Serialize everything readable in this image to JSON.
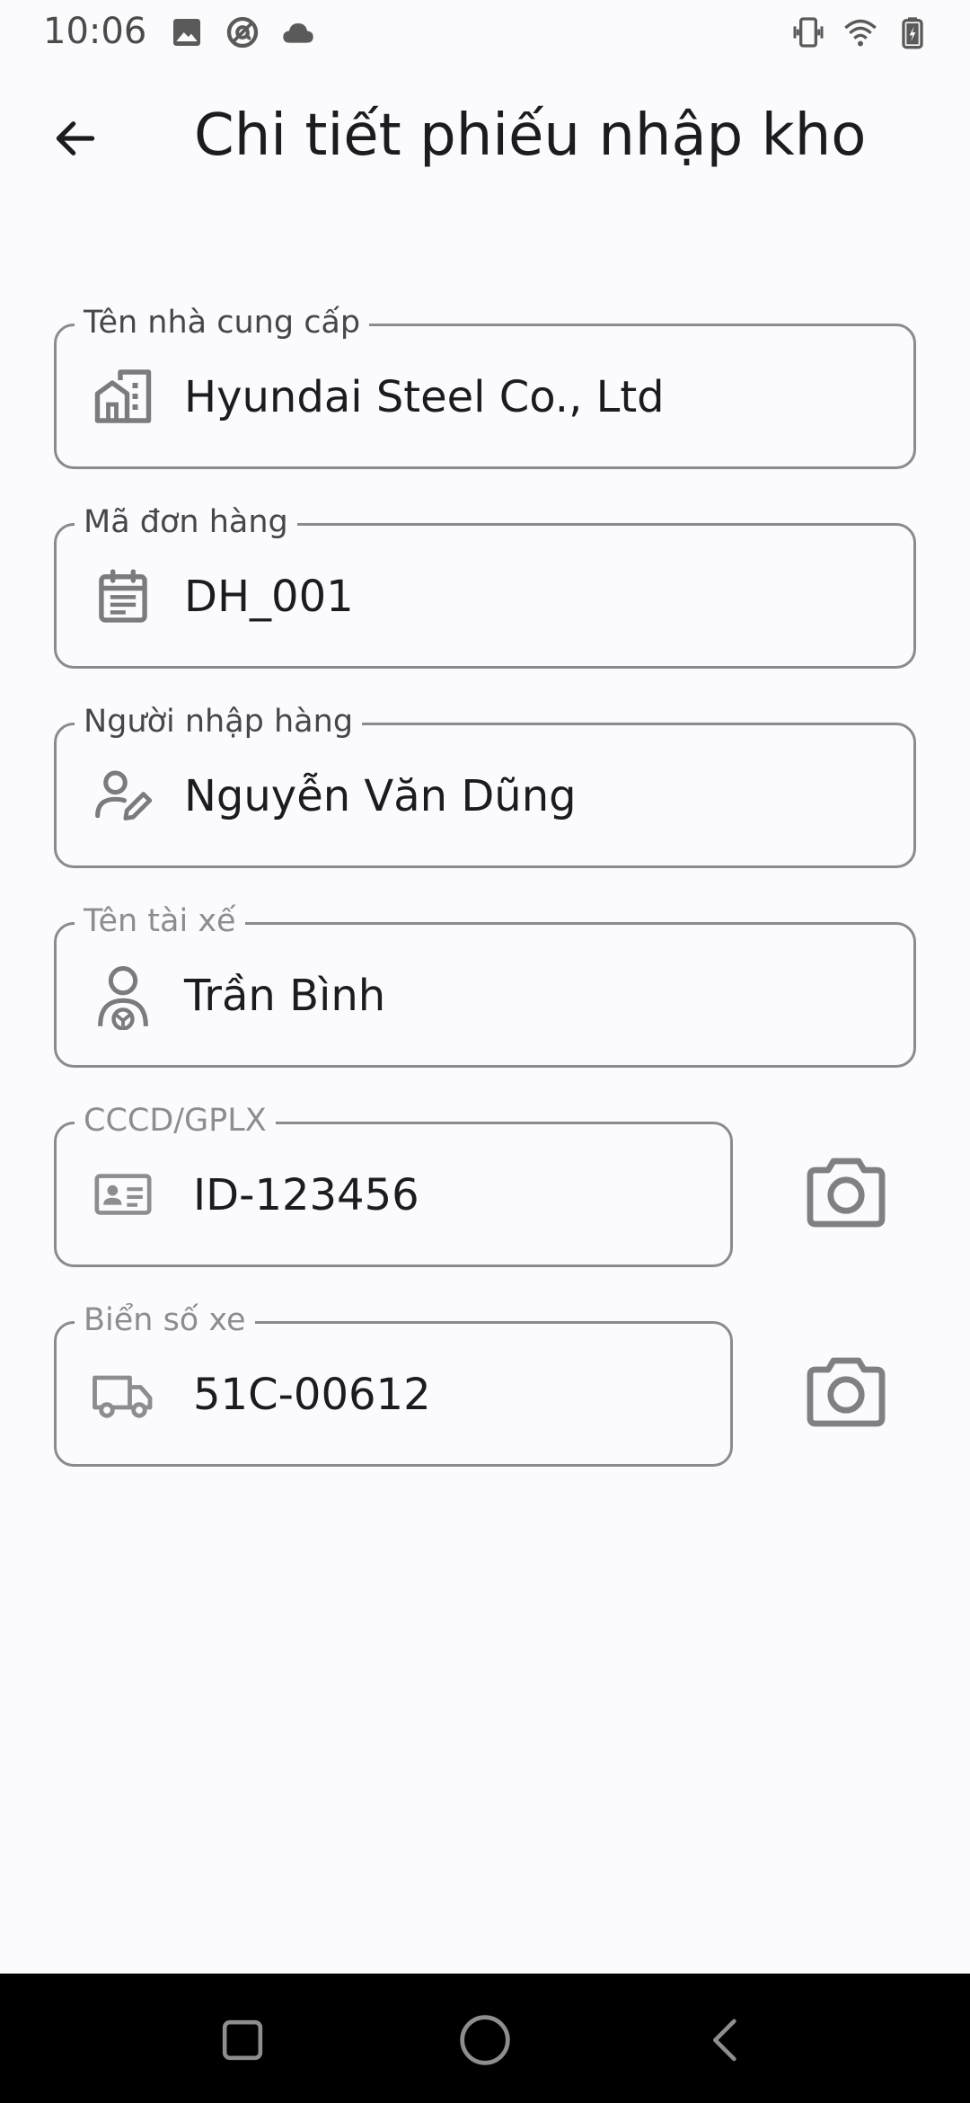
{
  "status_bar": {
    "time": "10:06",
    "left_icons": [
      "image-icon",
      "at-sign-icon",
      "cloud-icon"
    ],
    "right_icons": [
      "vibrate-icon",
      "wifi-icon",
      "battery-charging-icon"
    ]
  },
  "app_bar": {
    "title": "Chi tiết phiếu nhập kho",
    "back_icon": "arrow-back-icon"
  },
  "fields": {
    "supplier": {
      "label": "Tên nhà cung cấp",
      "value": "Hyundai Steel Co., Ltd",
      "icon": "building-icon"
    },
    "order_code": {
      "label": "Mã đơn hàng",
      "value": "DH_001",
      "icon": "calendar-icon"
    },
    "receiver": {
      "label": "Người nhập hàng",
      "value": "Nguyễn Văn Dũng",
      "icon": "person-edit-icon"
    },
    "driver": {
      "label": "Tên tài xế",
      "value": "Trần Bình",
      "icon": "driver-icon"
    },
    "id_card": {
      "label": "CCCD/GPLX",
      "value": "ID-123456",
      "icon": "id-card-icon",
      "action_icon": "camera-icon"
    },
    "plate": {
      "label": "Biển số xe",
      "value": "51C-00612",
      "icon": "truck-icon",
      "action_icon": "camera-icon"
    }
  },
  "nav_bar": {
    "buttons": [
      "recents-square-icon",
      "home-circle-icon",
      "back-chevron-icon"
    ]
  },
  "colors": {
    "background": "#fbfbfd",
    "outline": "#8c8a8f",
    "text": "#1d1b20",
    "icon": "#7b7a7e"
  }
}
